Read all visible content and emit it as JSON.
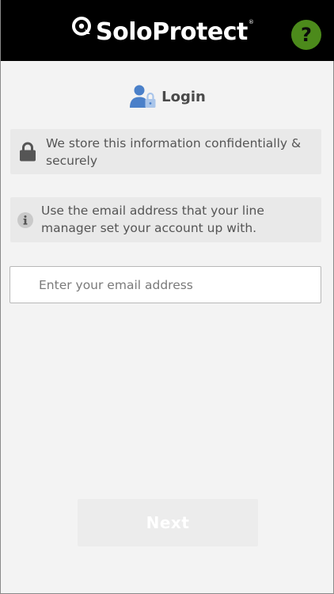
{
  "header": {
    "brand": "SoloProtect",
    "trademark": "®",
    "help_label": "?",
    "colors": {
      "background": "#000000",
      "help_button": "#4c8a1b"
    },
    "icons": {
      "brand_mark": "at-sign-logo-icon",
      "help": "question-mark-icon"
    }
  },
  "login": {
    "title": "Login",
    "icon": "user-lock-icon",
    "icon_color": "#4a80c9"
  },
  "notices": [
    {
      "icon": "padlock-icon",
      "text": "We store this information confidentially & securely"
    },
    {
      "icon": "info-icon",
      "text": "Use the email address that your line manager set your account up with."
    }
  ],
  "email": {
    "value": "",
    "placeholder": "Enter your email address"
  },
  "next_button": {
    "label": "Next"
  }
}
